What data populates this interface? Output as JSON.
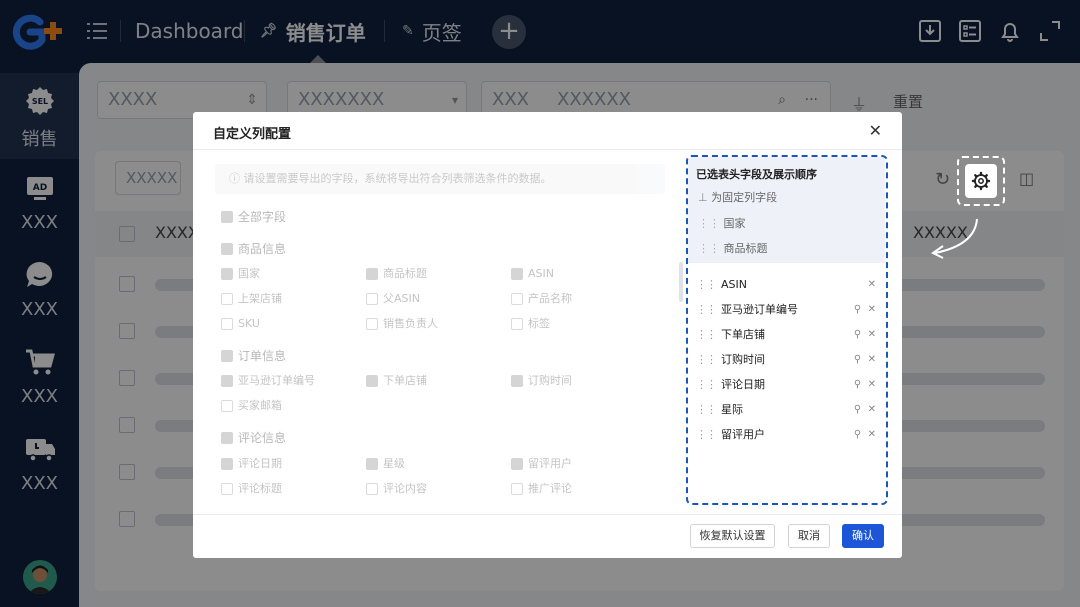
{
  "topbar": {
    "tabs": [
      {
        "label": "Dashboard"
      },
      {
        "label": "销售订单"
      },
      {
        "label": "页签"
      }
    ],
    "add_tab": "+"
  },
  "sidebar": {
    "items": [
      {
        "label": "销售",
        "icon": "sel-icon",
        "badge": "SEL"
      },
      {
        "label": "XXX",
        "icon": "ad-icon",
        "badge": "AD"
      },
      {
        "label": "XXX",
        "icon": "chat-icon"
      },
      {
        "label": "XXX",
        "icon": "cart-icon"
      },
      {
        "label": "XXX",
        "icon": "truck-icon"
      }
    ]
  },
  "filters": {
    "f1": "XXXX",
    "f2": "XXXXXXX",
    "f3a": "XXX",
    "f3b": "XXXXXX",
    "reset": "重置",
    "f4": "XXXXX",
    "col_header": "XXXX",
    "col_header_right": "XXXXX"
  },
  "modal": {
    "title": "自定义列配置",
    "notice": "请设置需要导出的字段，系统将导出符合列表筛选条件的数据。",
    "all_fields": "全部字段",
    "groups": [
      {
        "name": "商品信息",
        "fields": [
          {
            "label": "国家",
            "checked": true
          },
          {
            "label": "商品标题",
            "checked": true
          },
          {
            "label": "ASIN",
            "checked": true
          },
          {
            "label": "上架店铺",
            "checked": false
          },
          {
            "label": "父ASIN",
            "checked": false
          },
          {
            "label": "产品名称",
            "checked": false
          },
          {
            "label": "SKU",
            "checked": false
          },
          {
            "label": "销售负责人",
            "checked": false
          },
          {
            "label": "标签",
            "checked": false
          }
        ]
      },
      {
        "name": "订单信息",
        "fields": [
          {
            "label": "亚马逊订单编号",
            "checked": true
          },
          {
            "label": "下单店铺",
            "checked": true
          },
          {
            "label": "订购时间",
            "checked": true
          },
          {
            "label": "买家邮箱",
            "checked": false
          }
        ]
      },
      {
        "name": "评论信息",
        "fields": [
          {
            "label": "评论日期",
            "checked": true
          },
          {
            "label": "星级",
            "checked": true
          },
          {
            "label": "留评用户",
            "checked": true
          },
          {
            "label": "评论标题",
            "checked": false
          },
          {
            "label": "评论内容",
            "checked": false
          },
          {
            "label": "推广评论",
            "checked": false
          }
        ]
      }
    ],
    "right": {
      "title": "已选表头字段及展示顺序",
      "fixed_label": "为固定列字段",
      "fixed": [
        "国家",
        "商品标题"
      ],
      "selected": [
        "ASIN",
        "亚马逊订单编号",
        "下单店铺",
        "订购时间",
        "评论日期",
        "星际",
        "留评用户"
      ]
    },
    "buttons": {
      "restore": "恢复默认设置",
      "cancel": "取消",
      "confirm": "确认"
    }
  },
  "colors": {
    "nav_bg": "#11213f",
    "primary": "#1c56d6",
    "highlight_dash": "#1c56b8"
  }
}
